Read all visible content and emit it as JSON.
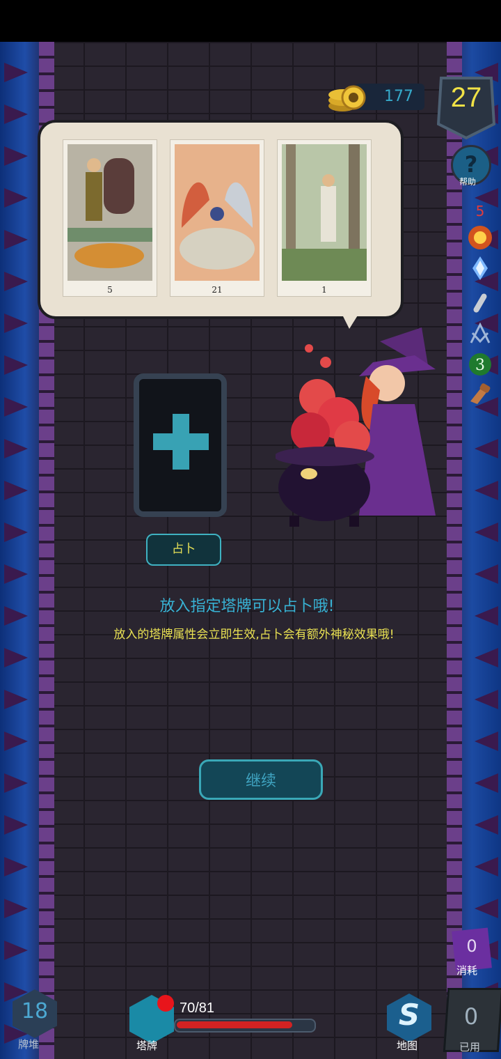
{
  "hud": {
    "coins": "177",
    "floor": "27",
    "help_label": "帮助",
    "side_badge": "5"
  },
  "cards": [
    {
      "number": "5"
    },
    {
      "number": "21"
    },
    {
      "number": "1"
    }
  ],
  "divine": {
    "button_label": "占卜",
    "title": "放入指定塔牌可以占卜哦!",
    "body": "放入的塔牌属性会立即生效,占卜会有额外神秘效果哦!"
  },
  "continue_label": "继续",
  "bottom": {
    "deck_count": "18",
    "deck_label": "牌堆",
    "tarot_label": "塔牌",
    "hp_text": "70/81",
    "hp_current": 70,
    "hp_max": 81,
    "map_label": "地图",
    "used_count": "0",
    "used_label": "已用",
    "consume_count": "0",
    "consume_label": "消耗"
  }
}
